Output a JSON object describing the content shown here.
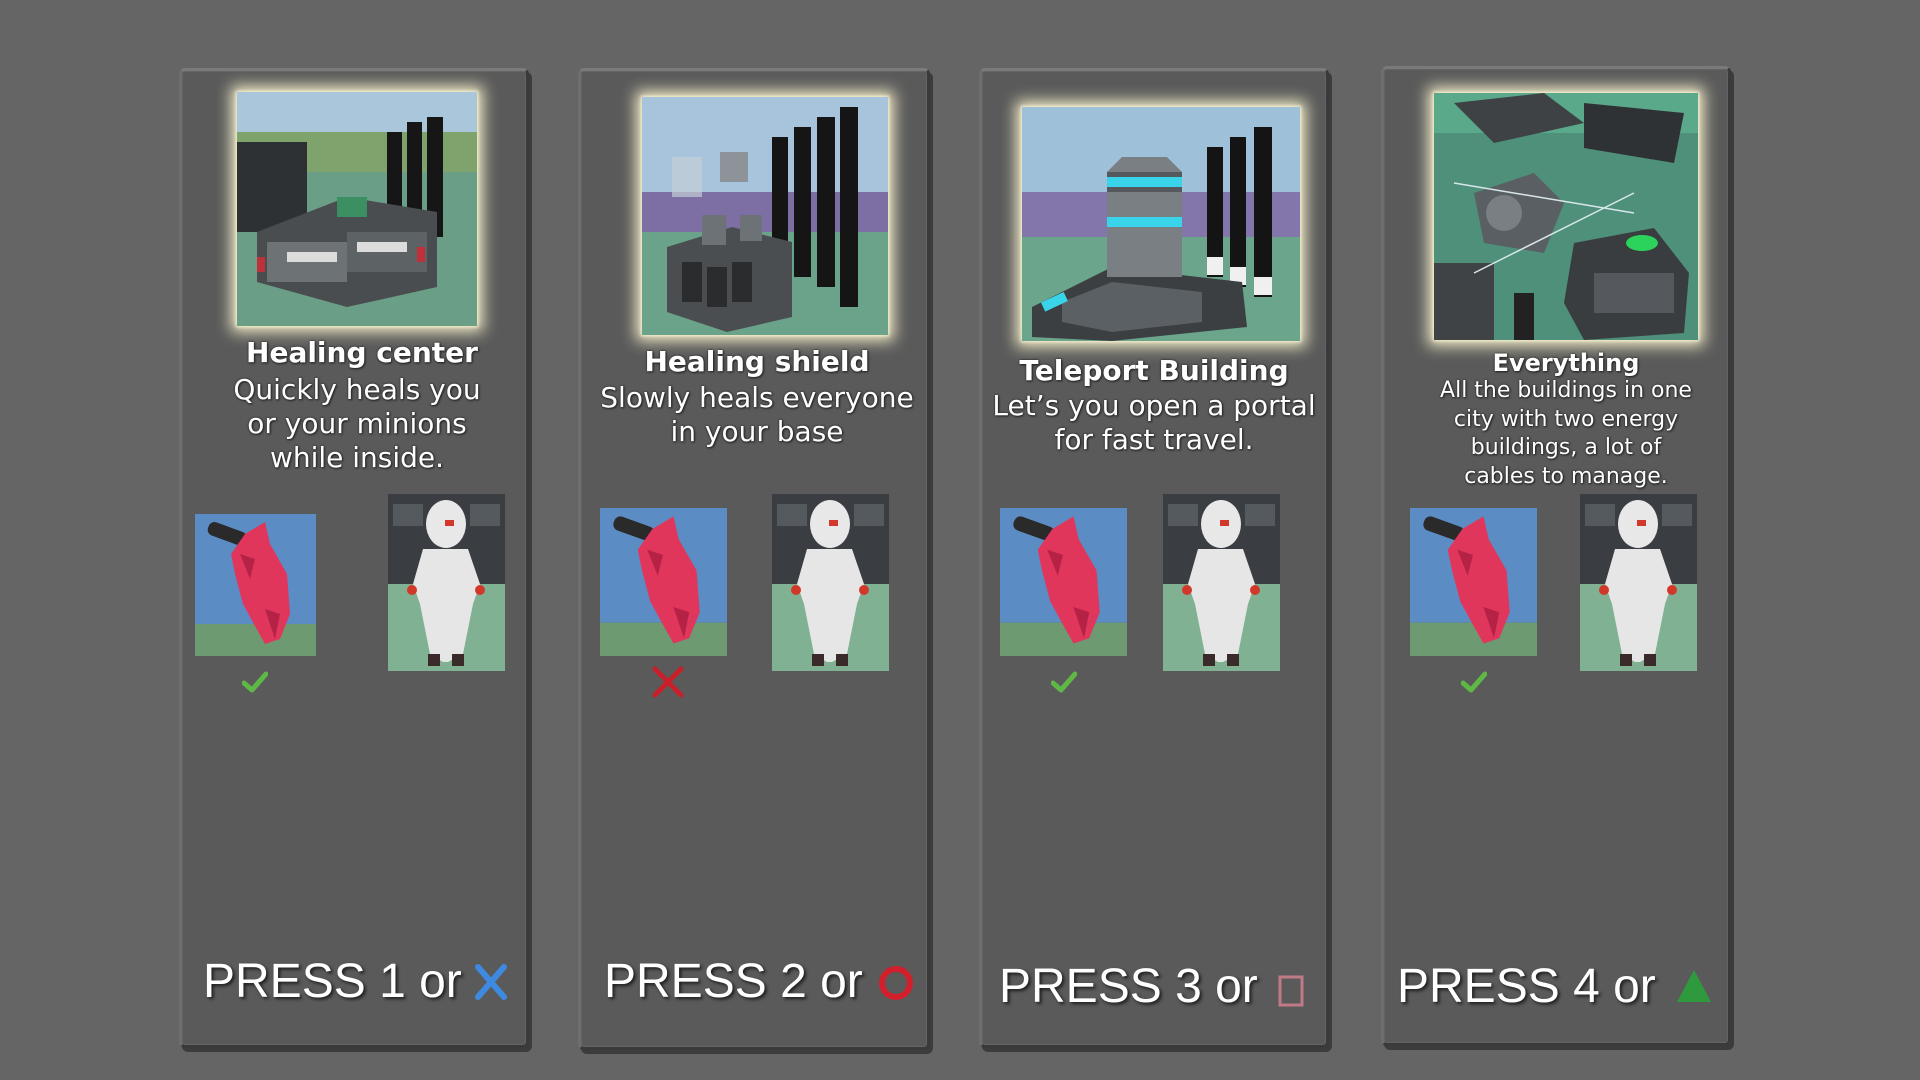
{
  "cards": [
    {
      "title": "Healing center",
      "description": [
        "Quickly heals you",
        "or your minions",
        "while inside."
      ],
      "monster_allowed": true,
      "press": {
        "text": "PRESS 1 or",
        "button": "cross",
        "button_color": "#3d8ae0"
      }
    },
    {
      "title": "Healing shield",
      "description": [
        "Slowly heals everyone",
        "in your base"
      ],
      "monster_allowed": false,
      "press": {
        "text": "PRESS 2 or",
        "button": "circle",
        "button_color": "#d11f2c"
      }
    },
    {
      "title": "Teleport Building",
      "description": [
        "Let’s you open a portal",
        "for fast travel."
      ],
      "monster_allowed": true,
      "press": {
        "text": "PRESS 3 or",
        "button": "square",
        "button_color": "#c07a86"
      }
    },
    {
      "title": "Everything",
      "description": [
        "All the buildings in one",
        "city with two energy",
        "buildings, a lot of",
        "cables to manage."
      ],
      "monster_allowed": true,
      "press": {
        "text": "PRESS 4 or",
        "button": "triangle",
        "button_color": "#2f9a3d"
      }
    }
  ],
  "colors": {
    "check": "#5fb845",
    "cross_mark": "#c8202a",
    "glow": "#f2ecc7"
  },
  "icons": [
    "check-icon",
    "x-mark-icon",
    "cross-button-icon",
    "circle-button-icon",
    "square-button-icon",
    "triangle-button-icon"
  ]
}
